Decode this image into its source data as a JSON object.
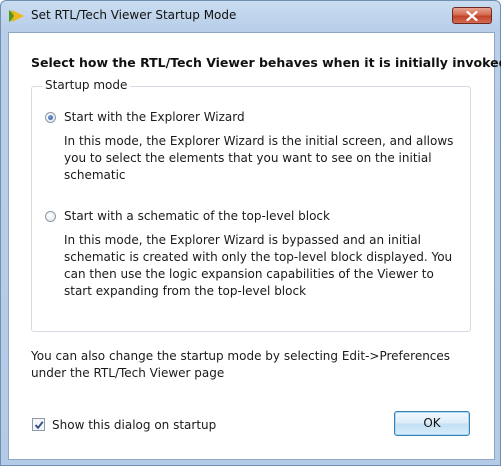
{
  "window": {
    "title": "Set RTL/Tech Viewer Startup Mode",
    "accent": "#b9cfe9",
    "icons": {
      "app": "vivado-logo-icon",
      "close": "close-icon"
    }
  },
  "dialog": {
    "heading": "Select how the RTL/Tech Viewer behaves when it is initially invoked",
    "group_label": "Startup mode",
    "options": [
      {
        "label": "Start with the Explorer Wizard",
        "selected": true,
        "description": "In this mode, the Explorer Wizard is the initial screen, and allows you to select the elements that you want to see on the initial schematic"
      },
      {
        "label": "Start with a schematic of the top-level block",
        "selected": false,
        "description": "In this mode, the Explorer Wizard is bypassed and an initial schematic is created with only the top-level block displayed. You can then use the logic expansion capabilities of the Viewer to start expanding from the top-level block"
      }
    ],
    "note": "You can also change the startup mode by selecting Edit->Preferences under the RTL/Tech Viewer page",
    "show_on_startup": {
      "label": "Show this dialog on startup",
      "checked": true
    },
    "ok_label": "OK"
  }
}
